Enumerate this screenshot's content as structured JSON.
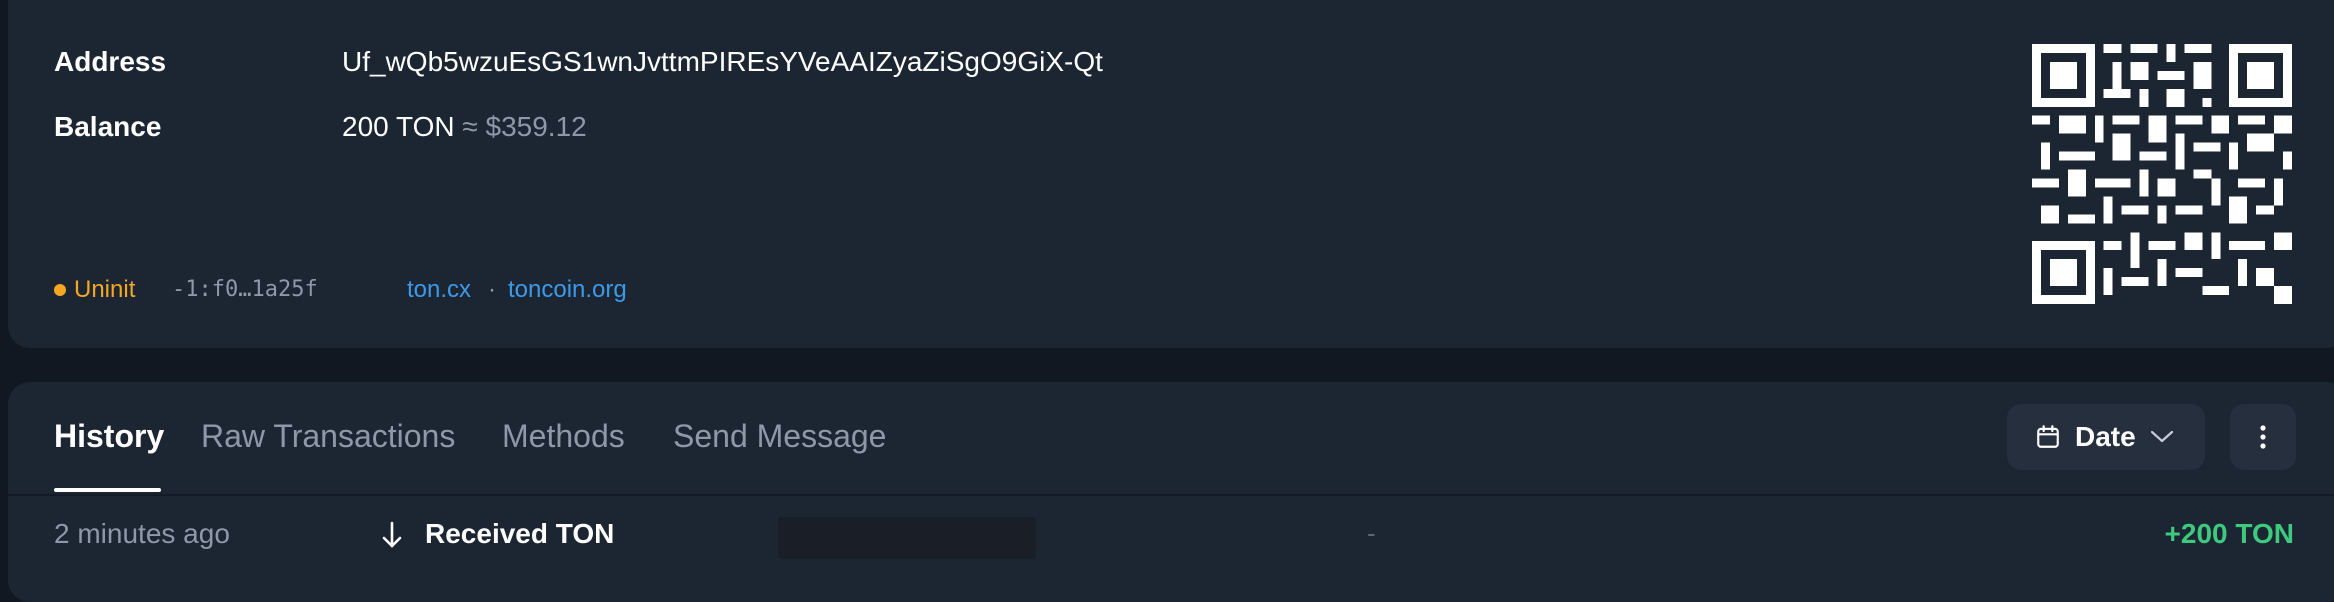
{
  "account": {
    "address_label": "Address",
    "address_value": "Uf_wQb5wzuEsGS1wnJvttmPIREsYVeAAIZyaZiSgO9GiX-Qt",
    "balance_label": "Balance",
    "balance_value": "200 TON",
    "balance_fiat": "≈ $359.12",
    "status": "Uninit",
    "status_color": "#f5a623",
    "raw_address_short": "-1:f0…1a25f",
    "link_1": "ton.cx",
    "link_separator": "·",
    "link_2": "toncoin.org",
    "link_color": "#3d9ae8"
  },
  "tabs": [
    {
      "label": "History",
      "active": true
    },
    {
      "label": "Raw Transactions",
      "active": false
    },
    {
      "label": "Methods",
      "active": false
    },
    {
      "label": "Send Message",
      "active": false
    }
  ],
  "toolbar": {
    "date_label": "Date",
    "date_icon": "calendar-icon",
    "dropdown_icon": "chevron-down-icon",
    "more_icon": "vertical-ellipsis-icon"
  },
  "history": [
    {
      "time": "2 minutes ago",
      "direction_icon": "arrow-down-icon",
      "title": "Received TON",
      "counterparty": "",
      "comment": "-",
      "amount": "+200 TON",
      "amount_color": "#3ec97e"
    }
  ],
  "colors": {
    "background": "#111822",
    "card": "#1c2532",
    "muted_text": "#8e99a8"
  }
}
